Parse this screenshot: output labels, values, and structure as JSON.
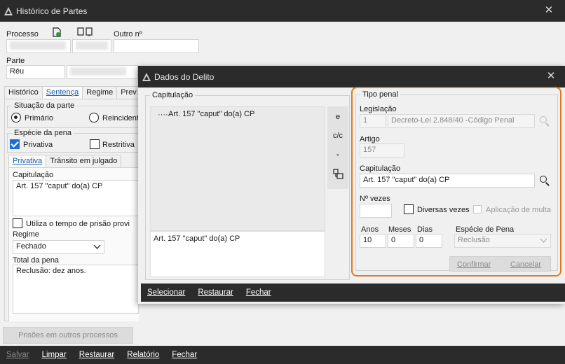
{
  "main": {
    "title": "Histórico de Partes",
    "processo_label": "Processo",
    "outro_label": "Outro nº",
    "parte_label": "Parte",
    "parte_value": "Réu",
    "tabs": [
      "Histórico",
      "Sentença",
      "Regime",
      "Prev"
    ],
    "situacao_label": "Situação da parte",
    "primario_label": "Primário",
    "reincidente_label": "Reincidente",
    "especie_label": "Espécie da pena",
    "privativa_label": "Privativa",
    "restritiva_label": "Restritiva",
    "subtabs": [
      "Privativa",
      "Trânsito em julgado"
    ],
    "capitulacao_label": "Capitulação",
    "capitulacao_value": "Art. 157 \"caput\" do(a) CP",
    "utiliza_label": "Utiliza o tempo de prisão provi",
    "regime_label": "Regime",
    "regime_value": "Fechado",
    "total_label": "Total da pena",
    "total_value": "Reclusão: dez anos.",
    "prisoes_button": "Prisões em outros processos",
    "bottom": [
      "Salvar",
      "Limpar",
      "Restaurar",
      "Relatório",
      "Fechar"
    ]
  },
  "modal": {
    "title": "Dados do Delito",
    "capitulacao_group": "Capitulação",
    "tree_item": "Art. 157 \"caput\" do(a) CP",
    "tool_e": "e",
    "tool_cc": "c/c",
    "tool_minus": "-",
    "preview_text": "Art. 157 \"caput\" do(a) CP",
    "tipo_penal": "Tipo penal",
    "legislacao_label": "Legislação",
    "legislacao_code": "1",
    "legislacao_value": "Decreto-Lei 2.848/40 -Código Penal",
    "artigo_label": "Artigo",
    "artigo_value": "157",
    "capitulacao_label": "Capitulação",
    "capitulacao_value": "Art. 157 \"caput\" do(a) CP",
    "nvezes_label": "Nº vezes",
    "diversas_label": "Diversas vezes",
    "aplicacao_label": "Aplicação de multa",
    "anos_label": "Anos",
    "meses_label": "Meses",
    "dias_label": "Dias",
    "anos_value": "10",
    "meses_value": "0",
    "dias_value": "0",
    "especie_label": "Espécie de Pena",
    "especie_value": "Reclusão",
    "confirmar": "Confirmar",
    "cancelar": "Cancelar",
    "bottom": [
      "Selecionar",
      "Restaurar",
      "Fechar"
    ]
  },
  "colors": {
    "accent": "#e07a1f",
    "bar": "#2b2b2b",
    "link": "#2060b0"
  }
}
